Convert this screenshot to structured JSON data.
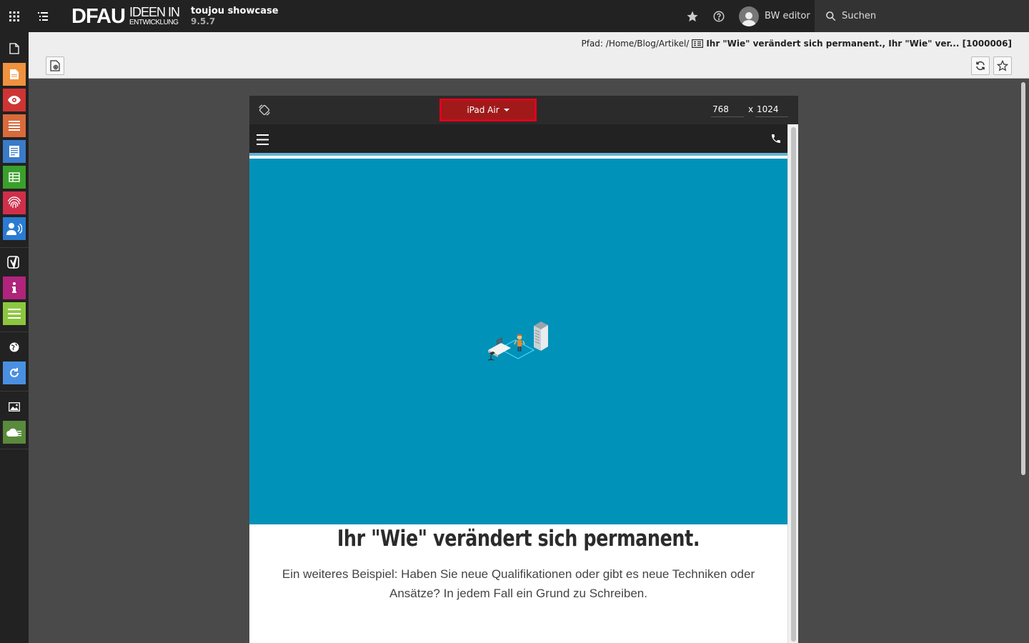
{
  "topbar": {
    "logo_main": "DFAU",
    "logo_line1": "IDEEN IN",
    "logo_line2": "ENTWICKLUNG",
    "site_name": "toujou showcase",
    "version": "9.5.7",
    "user_name": "BW editor",
    "search_label": "Suchen"
  },
  "modules": [
    {
      "name": "page-module",
      "icon": "page-icon",
      "color": ""
    },
    {
      "name": "list-module",
      "icon": "document-icon",
      "color": "#f0923e"
    },
    {
      "name": "view-module",
      "icon": "eye-icon",
      "color": "#cf3434"
    },
    {
      "name": "list-records-module",
      "icon": "list-icon",
      "color": "#d96a3b"
    },
    {
      "name": "form-module",
      "icon": "form-icon",
      "color": "#3a7bc8"
    },
    {
      "name": "table-module",
      "icon": "table-icon",
      "color": "#3b9f2c"
    },
    {
      "name": "fingerprint-module",
      "icon": "fingerprint-icon",
      "color": "#cf2f4a"
    },
    {
      "name": "users-module",
      "icon": "users-icon",
      "color": "#2a7bd1"
    },
    {
      "name": "yoast-module",
      "icon": "yoast-icon",
      "color": ""
    },
    {
      "name": "info-module",
      "icon": "info-icon",
      "color": "#b0247c"
    },
    {
      "name": "lines-module",
      "icon": "lines-icon",
      "color": "#8cc63f"
    },
    {
      "name": "globe-module",
      "icon": "globe-icon",
      "color": ""
    },
    {
      "name": "reload-module",
      "icon": "reload-icon",
      "color": "#4a90e2"
    },
    {
      "name": "image-module",
      "icon": "image-icon",
      "color": ""
    },
    {
      "name": "cloud-module",
      "icon": "cloud-icon",
      "color": "#5a8a3c"
    }
  ],
  "docheader": {
    "path_prefix": "Pfad: /Home/Blog/Artikel/",
    "record_title": "Ihr \"Wie\" verändert sich permanent., Ihr \"Wie\" ver... [1000006]"
  },
  "preview": {
    "device": "iPad Air",
    "width": "768",
    "height_prefix": "x",
    "height": "1024"
  },
  "article": {
    "title": "Ihr \"Wie\" verändert sich permanent.",
    "lead": "Ein weiteres Beispiel: Haben Sie neue Qualifikationen oder gibt es neue Techniken oder Ansätze? In jedem Fall ein Grund zu Schreiben."
  },
  "colors": {
    "hero": "#0092b8",
    "accent_red": "#e0001c",
    "topbar": "#222222"
  }
}
